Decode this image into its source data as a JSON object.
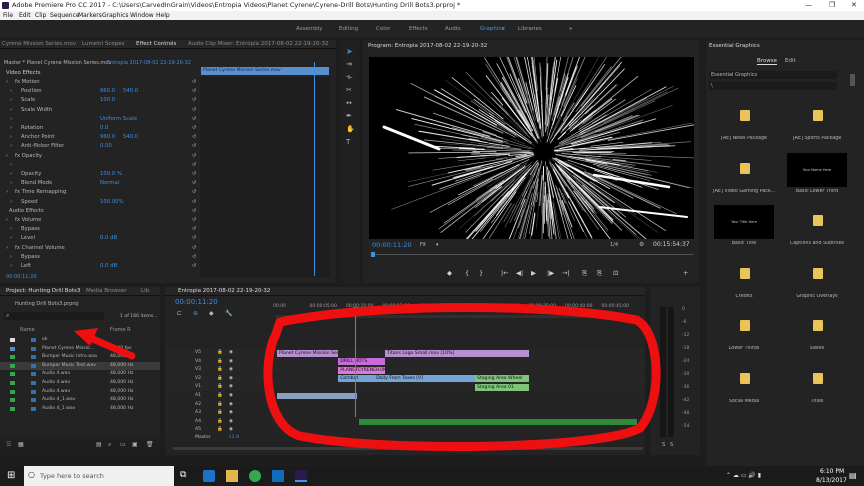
{
  "window": {
    "title": "Adobe Premiere Pro CC 2017 - C:\\Users\\CarvedInGrain\\Videos\\Entropia Videos\\Planet Cyrene\\Cyrene-Drill Bots\\Hunting Drill Bots3.prproj *",
    "controls": [
      "—",
      "❐",
      "✕"
    ]
  },
  "menu": [
    "File",
    "Edit",
    "Clip",
    "Sequence",
    "Markers",
    "Graphics",
    "Window",
    "Help"
  ],
  "workspaces": [
    "Assembly",
    "Editing",
    "Color",
    "Effects",
    "Audio",
    "Graphics",
    "Libraries"
  ],
  "workspaces_more": "»",
  "active_workspace": "Graphics",
  "effect_controls": {
    "tabs": [
      "Cyrene Mission Series.mov",
      "Lumetri Scopes",
      "Effect Controls",
      "Audio Clip Mixer: Entropia 2017-08-02 22-19-20-32"
    ],
    "master": "Master * Planet Cyrene Mission Series.mov",
    "sequence": "Entropia 2017-08-02 22-19-20-32",
    "mini_clip": "Planet Cyrene Mission Series.mov",
    "mini_tc": "00:00:00",
    "section_video": "Video Effects",
    "rows": [
      {
        "indent": 1,
        "label": "fx  Motion",
        "value": ""
      },
      {
        "indent": 2,
        "label": "Position",
        "value": "960.0",
        "value2": "540.0"
      },
      {
        "indent": 2,
        "label": "Scale",
        "value": "100.0",
        "value2": ""
      },
      {
        "indent": 2,
        "label": "Scale Width",
        "value": "",
        "value2": ""
      },
      {
        "indent": 2,
        "label": "",
        "value": "Uniform Scale",
        "value2": ""
      },
      {
        "indent": 2,
        "label": "Rotation",
        "value": "0.0",
        "value2": ""
      },
      {
        "indent": 2,
        "label": "Anchor Point",
        "value": "960.0",
        "value2": "540.0"
      },
      {
        "indent": 2,
        "label": "Anti-flicker Filter",
        "value": "0.00",
        "value2": ""
      },
      {
        "indent": 1,
        "label": "fx  Opacity",
        "value": "",
        "value2": ""
      },
      {
        "indent": 2,
        "label": "",
        "value": "",
        "value2": ""
      },
      {
        "indent": 2,
        "label": "Opacity",
        "value": "100.0 %",
        "value2": ""
      },
      {
        "indent": 2,
        "label": "Blend Mode",
        "value": "Normal",
        "value2": ""
      },
      {
        "indent": 1,
        "label": "fx  Time Remapping",
        "value": "",
        "value2": ""
      },
      {
        "indent": 2,
        "label": "Speed",
        "value": "100.00%",
        "value2": ""
      },
      {
        "indent": 0,
        "label": "Audio Effects",
        "value": "",
        "value2": ""
      },
      {
        "indent": 1,
        "label": "fx  Volume",
        "value": "",
        "value2": ""
      },
      {
        "indent": 2,
        "label": "Bypass",
        "value": "",
        "value2": ""
      },
      {
        "indent": 2,
        "label": "Level",
        "value": "0.0 dB",
        "value2": ""
      },
      {
        "indent": 1,
        "label": "fx  Channel Volume",
        "value": "",
        "value2": ""
      },
      {
        "indent": 2,
        "label": "Bypass",
        "value": "",
        "value2": ""
      },
      {
        "indent": 2,
        "label": "Left",
        "value": "0.0 dB",
        "value2": ""
      }
    ],
    "bottom_tc": "00:00:11:20"
  },
  "program": {
    "title": "Program: Entropia 2017-08-02 22-19-20-32",
    "timecode": "00:00:11:20",
    "fit": "Fit",
    "fraction": "1/4",
    "duration": "00:15:54:37",
    "controls": [
      "◆",
      "{",
      "}",
      "|←",
      "◀|",
      "▶",
      "|▶",
      "→|",
      "⎘",
      "⎘",
      "⊡",
      "+"
    ]
  },
  "essential_graphics": {
    "title": "Essential Graphics",
    "tabs": [
      "Browse",
      "Edit"
    ],
    "dropdown": "Essential Graphics",
    "search": "\\",
    "items": [
      {
        "label": "[AE] News Package",
        "kind": "folder"
      },
      {
        "label": "[AE] Sports Package",
        "kind": "folder"
      },
      {
        "label": "[AE] Video Gaming Pack...",
        "kind": "folder"
      },
      {
        "label": "Basic Lower Third",
        "kind": "thumb",
        "thumb_text": "Your Name Here"
      },
      {
        "label": "Basic Title",
        "kind": "thumb",
        "thumb_text": "Your Title Here"
      },
      {
        "label": "Captions and Subtitles",
        "kind": "folder"
      },
      {
        "label": "Credits",
        "kind": "folder"
      },
      {
        "label": "Graphic Overlays",
        "kind": "folder"
      },
      {
        "label": "Lower Thirds",
        "kind": "folder"
      },
      {
        "label": "Slates",
        "kind": "folder"
      },
      {
        "label": "Social Media",
        "kind": "folder"
      },
      {
        "label": "Titles",
        "kind": "folder"
      }
    ]
  },
  "project": {
    "tabs": [
      "Project: Hunting Drill Bots3",
      "Media Browser",
      "Lib"
    ],
    "file": "Hunting Drill Bots3.prproj",
    "count": "1 of 166 items...",
    "columns": [
      "Name",
      "Frame R"
    ],
    "rows": [
      {
        "name": "ok",
        "rate": "",
        "color": "#dcdcdc"
      },
      {
        "name": "Planet Cyrene Missio...",
        "rate": "30.00 fps",
        "color": "#5b8cc7"
      },
      {
        "name": "Bumper Music Intro.wav",
        "rate": "48,000 Hz",
        "color": "#2fa84f"
      },
      {
        "name": "Bumper Music Test.wav",
        "rate": "48,000 Hz",
        "color": "#2fa84f"
      },
      {
        "name": "Audio 4.wav",
        "rate": "48,000 Hz",
        "color": "#2fa84f"
      },
      {
        "name": "Audio 4.wav",
        "rate": "48,000 Hz",
        "color": "#2fa84f"
      },
      {
        "name": "Audio 4.wav",
        "rate": "48,000 Hz",
        "color": "#2fa84f"
      },
      {
        "name": "Audio 4_1.wav",
        "rate": "48,000 Hz",
        "color": "#2fa84f"
      },
      {
        "name": "Audio 4_1.wav",
        "rate": "48,000 Hz",
        "color": "#2fa84f"
      }
    ]
  },
  "timeline": {
    "title": "Entropia 2017-08-02 22-19-20-32",
    "timecode": "00:00:11:20",
    "ruler": [
      "00:00",
      "00:00:05:00",
      "00:00:10:00",
      "00:00:15:00",
      "00:00:20:00",
      "00:00:25:00",
      "00:00:30:00",
      "00:00:35:00",
      "00:00:40:00",
      "00:00:45:00"
    ],
    "tracks": [
      "V5",
      "V4",
      "V3",
      "V2",
      "V1",
      "A1",
      "A2",
      "A3",
      "A4",
      "A5"
    ],
    "master_label": "Master",
    "master_value": "-12.9",
    "clips": [
      {
        "track": "V5",
        "label": "Planet Cyrene Mission Series.mov [V]",
        "color": "#b58fcf",
        "start": 0.0,
        "end": 17.0
      },
      {
        "track": "V5",
        "label": "Titans Logo Small.mov [10%]",
        "color": "#b58fcf",
        "start": 30.0,
        "end": 70.0
      },
      {
        "track": "V4",
        "label": "DRILL BOTS",
        "color": "#c66bd9",
        "start": 17.0,
        "end": 30.0
      },
      {
        "track": "V3",
        "label": "PLANETCYRENEHUNTING",
        "color": "#d97ad9",
        "start": 17.0,
        "end": 30.0
      },
      {
        "track": "V2",
        "label": "Combat",
        "color": "#74a3d6",
        "start": 17.0,
        "end": 27.0
      },
      {
        "track": "V2",
        "label": "Daily From Taxes [V]",
        "color": "#74a3d6",
        "start": 27.0,
        "end": 55.0
      },
      {
        "track": "V2",
        "label": "Staging Area Wheel",
        "color": "#7fc47a",
        "start": 55.0,
        "end": 70.0
      },
      {
        "track": "V1",
        "label": "Staging Area 01",
        "color": "#7fc47a",
        "start": 55.0,
        "end": 70.0
      }
    ],
    "meter_scale": [
      "0",
      "-6",
      "-12",
      "-18",
      "-24",
      "-30",
      "-36",
      "-42",
      "-48",
      "-54"
    ],
    "meter_bottom": [
      "S",
      "S"
    ]
  },
  "taskbar": {
    "search": "Type here to search",
    "time": "6:10 PM",
    "date": "8/13/2017"
  },
  "colors": {
    "accent": "#4f8ee8",
    "annotation": "#ee1010",
    "playhead": "#3d8fe0"
  }
}
